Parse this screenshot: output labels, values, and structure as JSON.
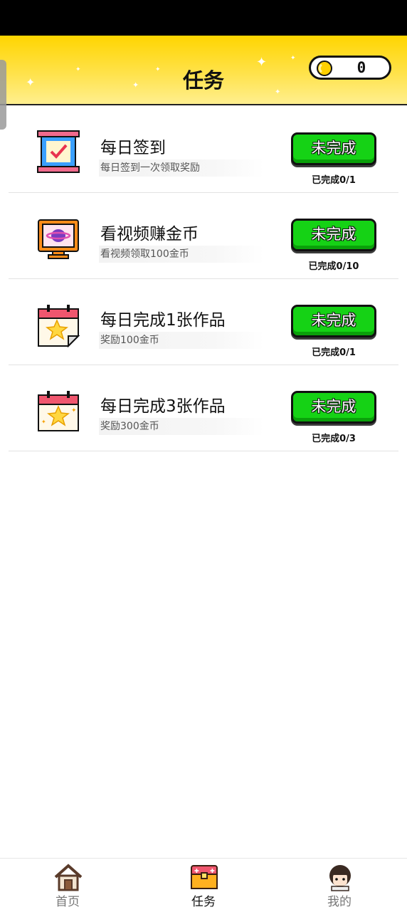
{
  "header": {
    "title": "任务",
    "coin_balance": "0"
  },
  "tasks": [
    {
      "title": "每日签到",
      "description": "每日签到一次领取奖励",
      "button_label": "未完成",
      "progress": "已完成0/1",
      "icon": "check-sign-in-icon"
    },
    {
      "title": "看视频赚金币",
      "description": "看视频领取100金币",
      "button_label": "未完成",
      "progress": "已完成0/10",
      "icon": "tv-planet-icon"
    },
    {
      "title": "每日完成1张作品",
      "description": "奖励100金币",
      "button_label": "未完成",
      "progress": "已完成0/1",
      "icon": "calendar-star-icon"
    },
    {
      "title": "每日完成3张作品",
      "description": "奖励300金币",
      "button_label": "未完成",
      "progress": "已完成0/3",
      "icon": "calendar-sparkle-star-icon"
    }
  ],
  "nav": [
    {
      "label": "首页",
      "icon": "home-icon",
      "active": false
    },
    {
      "label": "任务",
      "icon": "treasure-chest-icon",
      "active": true
    },
    {
      "label": "我的",
      "icon": "avatar-girl-icon",
      "active": false
    }
  ],
  "colors": {
    "header_yellow": "#ffd500",
    "button_green": "#15d215",
    "coin_gold": "#ffd000"
  }
}
